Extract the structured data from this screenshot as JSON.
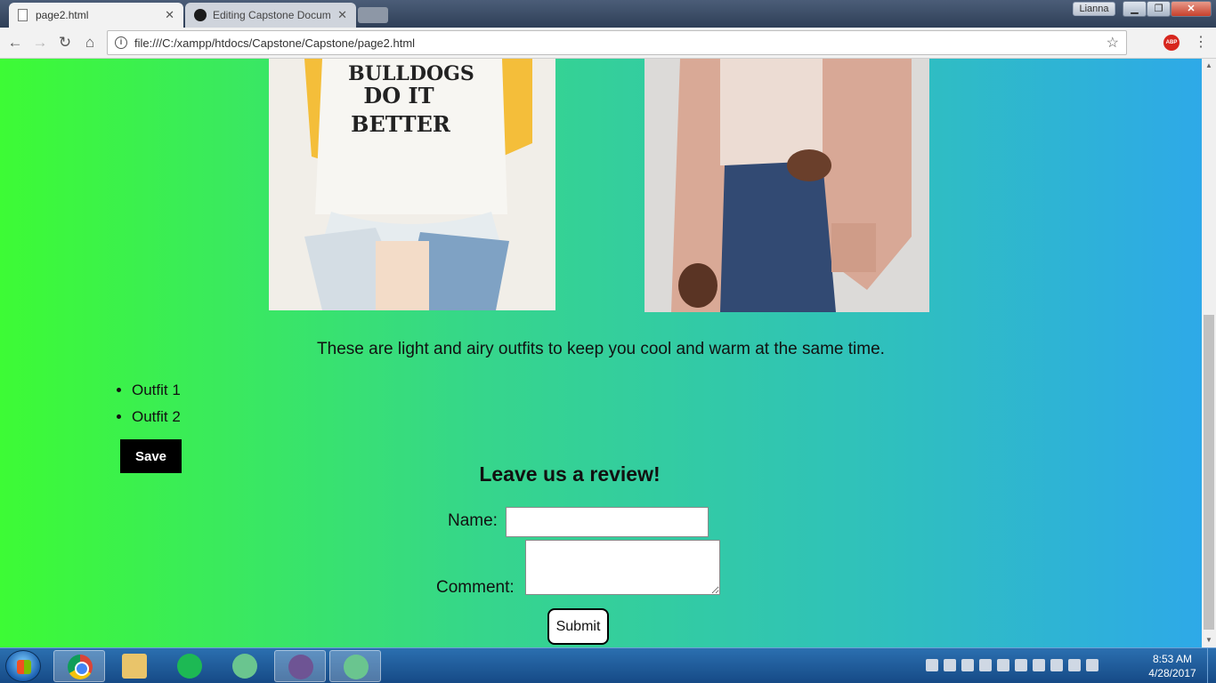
{
  "browser": {
    "tabs": [
      {
        "label": "page2.html",
        "active": true
      },
      {
        "label": "Editing Capstone Docum",
        "active": false
      }
    ],
    "user": "Lianna",
    "url": "file:///C:/xampp/htdocs/Capstone/Capstone/page2.html",
    "extension_label": "ABP"
  },
  "page": {
    "photo1_text": "BULLDOGS\nDO IT\nBETTER",
    "description": "These are light and airy outfits to keep you cool and warm at the same time.",
    "outfits": [
      "Outfit 1",
      "Outfit 2"
    ],
    "save_label": "Save",
    "review": {
      "title": "Leave us a review!",
      "name_label": "Name:",
      "name_value": "",
      "comment_label": "Comment:",
      "comment_value": "",
      "submit_label": "Submit"
    },
    "gradient_colors": [
      "#3dfb35",
      "#36d68b",
      "#2fbfbf",
      "#2ea9e8"
    ]
  },
  "taskbar": {
    "apps": [
      "chrome-icon",
      "file-explorer-icon",
      "spotify-icon",
      "atom-icon",
      "github-desktop-icon",
      "atom-icon"
    ],
    "time": "8:53 AM",
    "date": "4/28/2017"
  }
}
